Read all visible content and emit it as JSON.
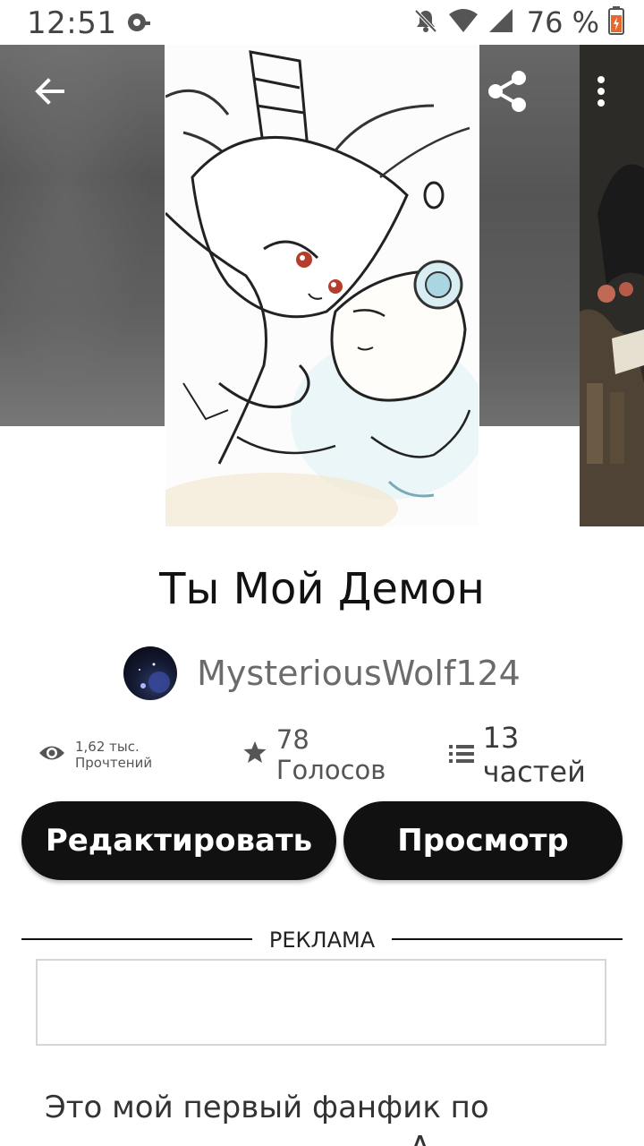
{
  "status_bar": {
    "time": "12:51",
    "battery_percent": "76 %",
    "icons": [
      "app-notification-icon",
      "mute-bell-icon",
      "wifi-icon",
      "cell-signal-icon",
      "battery-icon"
    ]
  },
  "header": {
    "back_icon": "arrow-left-icon",
    "share_icon": "share-icon",
    "more_icon": "more-vertical-icon"
  },
  "story": {
    "title": "Ты Мой Демон",
    "author": "MysteriousWolf124",
    "stats": {
      "reads": "1,62 тыс. Прочтений",
      "votes": "78 Голосов",
      "parts": "13 частей"
    }
  },
  "actions": {
    "edit_label": "Редактировать",
    "view_label": "Просмотр"
  },
  "ad": {
    "label": "РЕКЛАМА"
  },
  "description": {
    "first_line": "Это мой первый фанфик по",
    "partial_second_line": "А"
  },
  "colors": {
    "button_bg": "#111111",
    "button_text": "#ffffff",
    "author_text": "#6b6b6b"
  }
}
